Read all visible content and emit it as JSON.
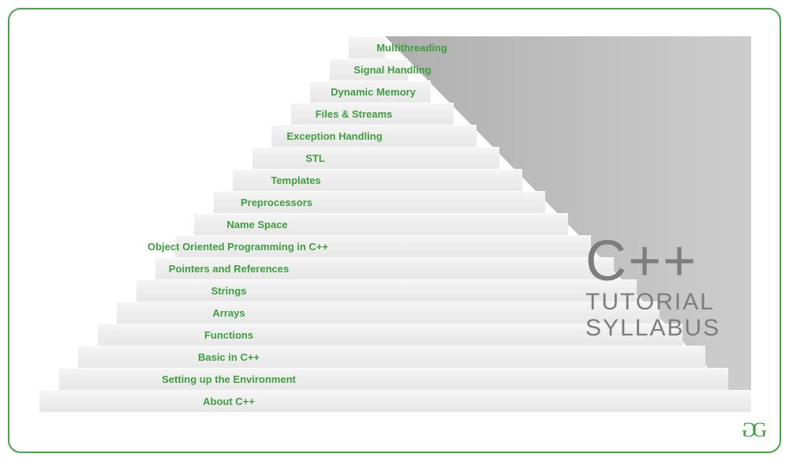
{
  "colors": {
    "accent": "#3f9e3f",
    "border": "#4ea24e",
    "stair_face": "#e9e9e9",
    "stair_side": "#8e8e8e",
    "title": "#7d7d7d"
  },
  "title": {
    "main": "C++",
    "line1": "TUTORIAL",
    "line2": "SYLLABUS"
  },
  "logo": "GG",
  "steps": [
    "About C++",
    "Setting up the Environment",
    "Basic in C++",
    "Functions",
    "Arrays",
    "Strings",
    "Pointers and References",
    "Object Oriented Programming in C++",
    "Name Space",
    "Preprocessors",
    "Templates",
    "STL",
    "Exception Handling",
    "Files & Streams",
    "Dynamic Memory",
    "Signal Handling",
    "Multithreading"
  ]
}
